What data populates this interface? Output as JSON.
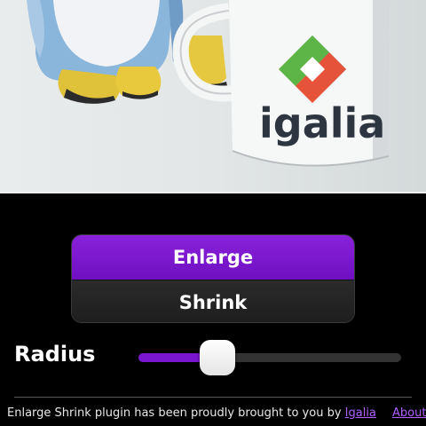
{
  "photo": {
    "description_icon": "penguin-and-mug-photo",
    "mug_brand": "igalia"
  },
  "segmented": {
    "enlarge_label": "Enlarge",
    "shrink_label": "Shrink",
    "selected": "Enlarge"
  },
  "radius": {
    "label": "Radius",
    "value_fraction": 0.3
  },
  "footer": {
    "text": "Enlarge Shrink plugin has been proudly brought to you by ",
    "link_label": "Igalia",
    "about_label": "About"
  },
  "colors": {
    "accent": "#7a16d0",
    "background": "#000000",
    "link": "#b060ff"
  }
}
